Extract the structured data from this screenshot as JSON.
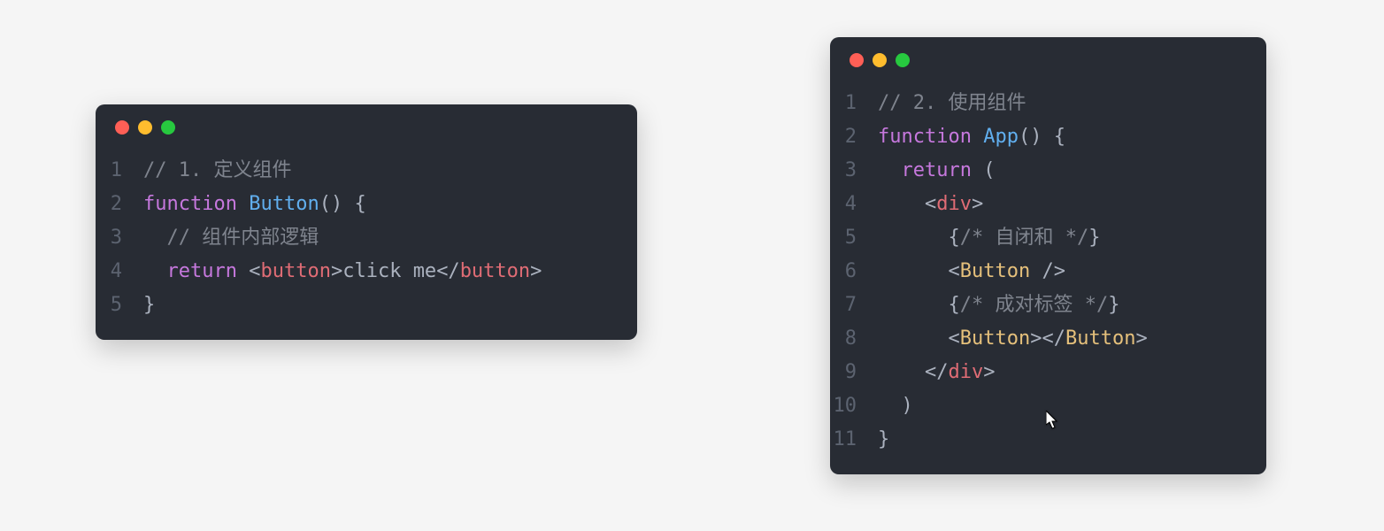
{
  "left_window": {
    "lines": [
      {
        "num": "1",
        "tokens": [
          {
            "cls": "tok-comment",
            "text": "// 1. 定义组件"
          }
        ]
      },
      {
        "num": "2",
        "tokens": [
          {
            "cls": "tok-keyword",
            "text": "function"
          },
          {
            "cls": "tok-text",
            "text": " "
          },
          {
            "cls": "tok-func",
            "text": "Button"
          },
          {
            "cls": "tok-punc",
            "text": "() {"
          }
        ]
      },
      {
        "num": "3",
        "tokens": [
          {
            "cls": "tok-text",
            "text": "  "
          },
          {
            "cls": "tok-comment",
            "text": "// 组件内部逻辑"
          }
        ]
      },
      {
        "num": "4",
        "tokens": [
          {
            "cls": "tok-text",
            "text": "  "
          },
          {
            "cls": "tok-keyword",
            "text": "return"
          },
          {
            "cls": "tok-text",
            "text": " "
          },
          {
            "cls": "tok-angle",
            "text": "<"
          },
          {
            "cls": "tok-tag",
            "text": "button"
          },
          {
            "cls": "tok-angle",
            "text": ">"
          },
          {
            "cls": "tok-text",
            "text": "click me"
          },
          {
            "cls": "tok-angle",
            "text": "</"
          },
          {
            "cls": "tok-tag",
            "text": "button"
          },
          {
            "cls": "tok-angle",
            "text": ">"
          }
        ]
      },
      {
        "num": "5",
        "tokens": [
          {
            "cls": "tok-punc",
            "text": "}"
          }
        ]
      }
    ]
  },
  "right_window": {
    "lines": [
      {
        "num": "1",
        "tokens": [
          {
            "cls": "tok-comment",
            "text": "// 2. 使用组件"
          }
        ]
      },
      {
        "num": "2",
        "tokens": [
          {
            "cls": "tok-keyword",
            "text": "function"
          },
          {
            "cls": "tok-text",
            "text": " "
          },
          {
            "cls": "tok-func",
            "text": "App"
          },
          {
            "cls": "tok-punc",
            "text": "() {"
          }
        ]
      },
      {
        "num": "3",
        "tokens": [
          {
            "cls": "tok-text",
            "text": "  "
          },
          {
            "cls": "tok-keyword",
            "text": "return"
          },
          {
            "cls": "tok-text",
            "text": " "
          },
          {
            "cls": "tok-punc",
            "text": "("
          }
        ]
      },
      {
        "num": "4",
        "tokens": [
          {
            "cls": "tok-text",
            "text": "    "
          },
          {
            "cls": "tok-angle",
            "text": "<"
          },
          {
            "cls": "tok-tag",
            "text": "div"
          },
          {
            "cls": "tok-angle",
            "text": ">"
          }
        ]
      },
      {
        "num": "5",
        "tokens": [
          {
            "cls": "tok-text",
            "text": "      "
          },
          {
            "cls": "tok-punc",
            "text": "{"
          },
          {
            "cls": "tok-comment",
            "text": "/* 自闭和 */"
          },
          {
            "cls": "tok-punc",
            "text": "}"
          }
        ]
      },
      {
        "num": "6",
        "tokens": [
          {
            "cls": "tok-text",
            "text": "      "
          },
          {
            "cls": "tok-angle",
            "text": "<"
          },
          {
            "cls": "tok-component",
            "text": "Button"
          },
          {
            "cls": "tok-text",
            "text": " "
          },
          {
            "cls": "tok-angle",
            "text": "/>"
          }
        ]
      },
      {
        "num": "7",
        "tokens": [
          {
            "cls": "tok-text",
            "text": "      "
          },
          {
            "cls": "tok-punc",
            "text": "{"
          },
          {
            "cls": "tok-comment",
            "text": "/* 成对标签 */"
          },
          {
            "cls": "tok-punc",
            "text": "}"
          }
        ]
      },
      {
        "num": "8",
        "tokens": [
          {
            "cls": "tok-text",
            "text": "      "
          },
          {
            "cls": "tok-angle",
            "text": "<"
          },
          {
            "cls": "tok-component",
            "text": "Button"
          },
          {
            "cls": "tok-angle",
            "text": ">"
          },
          {
            "cls": "tok-angle",
            "text": "</"
          },
          {
            "cls": "tok-component",
            "text": "Button"
          },
          {
            "cls": "tok-angle",
            "text": ">"
          }
        ]
      },
      {
        "num": "9",
        "tokens": [
          {
            "cls": "tok-text",
            "text": "    "
          },
          {
            "cls": "tok-angle",
            "text": "</"
          },
          {
            "cls": "tok-tag",
            "text": "div"
          },
          {
            "cls": "tok-angle",
            "text": ">"
          }
        ]
      },
      {
        "num": "10",
        "tokens": [
          {
            "cls": "tok-text",
            "text": "  "
          },
          {
            "cls": "tok-punc",
            "text": ")"
          }
        ]
      },
      {
        "num": "11",
        "tokens": [
          {
            "cls": "tok-punc",
            "text": "}"
          }
        ]
      }
    ]
  }
}
